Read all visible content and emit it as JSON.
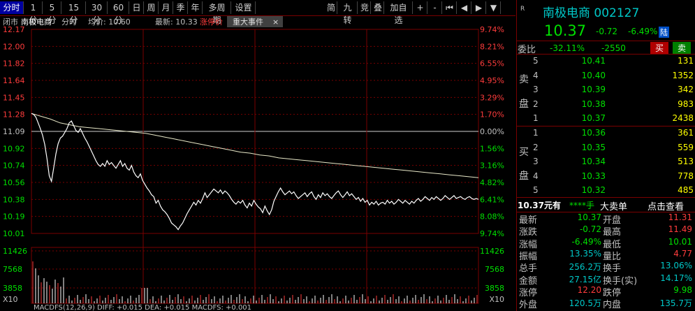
{
  "period_tabs": [
    "分时",
    "1分",
    "5分",
    "15分",
    "30分",
    "60分",
    "日",
    "周",
    "月",
    "季",
    "年",
    "多周期",
    "设置"
  ],
  "tool_tabs": [
    "简",
    "九转",
    "竞",
    "叠",
    "加自选",
    "+",
    "-",
    "⏮",
    "◀",
    "▶",
    "▼"
  ],
  "info_bar": {
    "closed": "闭市",
    "name": "南极电商",
    "mode": "分时",
    "avg_label": "均价:",
    "avg_value": "10.60",
    "latest_label": "最新:",
    "latest_value": "10.33",
    "limit_label": "涨停价",
    "event_tab": "重大事件",
    "event_close": "×"
  },
  "price_ticks": [
    "12.17",
    "12.00",
    "11.82",
    "11.64",
    "11.45",
    "11.28",
    "11.09",
    "10.92",
    "10.74",
    "10.56",
    "10.38",
    "10.19",
    "10.01"
  ],
  "pct_ticks": [
    "9.74%",
    "8.21%",
    "6.55%",
    "4.95%",
    "3.29%",
    "1.70%",
    "0.00%",
    "1.56%",
    "3.16%",
    "4.82%",
    "6.41%",
    "8.08%",
    "9.74%"
  ],
  "vol_ticks": [
    "11426",
    "7568",
    "3858"
  ],
  "vol_unit": "X10",
  "macd_label": "MACDFS(12,26,9)  DIFF: +0.015  DEA: +0.015  MACDFS: +0.001",
  "chart_data": {
    "type": "line",
    "title": "",
    "yaxis_base": 11.09,
    "ylim": [
      10.01,
      12.17
    ],
    "price": [
      11.28,
      11.27,
      11.24,
      11.18,
      11.12,
      11.05,
      10.95,
      10.8,
      10.62,
      10.56,
      10.7,
      10.85,
      10.96,
      11.02,
      11.04,
      11.08,
      11.12,
      11.18,
      11.2,
      11.15,
      11.1,
      11.08,
      11.12,
      11.07,
      11.02,
      10.98,
      10.93,
      10.88,
      10.83,
      10.78,
      10.74,
      10.72,
      10.75,
      10.72,
      10.78,
      10.74,
      10.76,
      10.73,
      10.7,
      10.74,
      10.78,
      10.72,
      10.75,
      10.7,
      10.68,
      10.73,
      10.66,
      10.62,
      10.6,
      10.64,
      10.57,
      10.53,
      10.49,
      10.46,
      10.42,
      10.4,
      10.33,
      10.36,
      10.3,
      10.26,
      10.24,
      10.21,
      10.17,
      10.12,
      10.1,
      10.08,
      10.05,
      10.09,
      10.12,
      10.17,
      10.22,
      10.26,
      10.3,
      10.34,
      10.31,
      10.36,
      10.33,
      10.38,
      10.44,
      10.39,
      10.42,
      10.45,
      10.48,
      10.46,
      10.44,
      10.47,
      10.43,
      10.46,
      10.44,
      10.41,
      10.37,
      10.34,
      10.32,
      10.35,
      10.33,
      10.36,
      10.31,
      10.28,
      10.33,
      10.3,
      10.36,
      10.32,
      10.29,
      10.27,
      10.23,
      10.3,
      10.25,
      10.21,
      10.26,
      10.35,
      10.4,
      10.45,
      10.49,
      10.45,
      10.42,
      10.44,
      10.46,
      10.43,
      10.45,
      10.41,
      10.38,
      10.4,
      10.42,
      10.44,
      10.4,
      10.43,
      10.45,
      10.4,
      10.37,
      10.42,
      10.39,
      10.44,
      10.41,
      10.43,
      10.4,
      10.38,
      10.41,
      10.44,
      10.46,
      10.42,
      10.39,
      10.42,
      10.45,
      10.41,
      10.43,
      10.4,
      10.37,
      10.39,
      10.35,
      10.38,
      10.34,
      10.36,
      10.31,
      10.34,
      10.32,
      10.35,
      10.31,
      10.33,
      10.34,
      10.32,
      10.36,
      10.33,
      10.35,
      10.32,
      10.34,
      10.37,
      10.35,
      10.33,
      10.36,
      10.34,
      10.32,
      10.35,
      10.33,
      10.36,
      10.38,
      10.35,
      10.37,
      10.4,
      10.38,
      10.36,
      10.39,
      10.37,
      10.4,
      10.38,
      10.36,
      10.38,
      10.41,
      10.39,
      10.37,
      10.39,
      10.41,
      10.38,
      10.39,
      10.4,
      10.38,
      10.37,
      10.39,
      10.4,
      10.38,
      10.37,
      10.38,
      10.37
    ],
    "avg": [
      11.28,
      11.25,
      11.22,
      11.18,
      11.16,
      11.14,
      11.13,
      11.12,
      11.11,
      11.1,
      11.09,
      11.08,
      11.07,
      11.05,
      11.03,
      11.01,
      10.99,
      10.97,
      10.95,
      10.93,
      10.91,
      10.89,
      10.87,
      10.86,
      10.84,
      10.83,
      10.81,
      10.8,
      10.79,
      10.78,
      10.77,
      10.76,
      10.75,
      10.74,
      10.73,
      10.72,
      10.71,
      10.7,
      10.69,
      10.68,
      10.67,
      10.66,
      10.65,
      10.64,
      10.63,
      10.62,
      10.61,
      10.6
    ]
  },
  "right": {
    "flag": "R",
    "stock_name": "南极电商 002127",
    "price": "10.37",
    "change": "-0.72",
    "change_pct": "-6.49%",
    "tag": "陆",
    "weibi_label": "委比",
    "weibi_pct": "-32.11%",
    "weibi_diff": "-2550",
    "buy_btn": "买",
    "sell_btn": "卖",
    "sell_label": [
      "卖",
      "盘"
    ],
    "buy_label": [
      "买",
      "盘"
    ],
    "asks": [
      {
        "lvl": "5",
        "price": "10.41",
        "vol": "131"
      },
      {
        "lvl": "4",
        "price": "10.40",
        "vol": "1352"
      },
      {
        "lvl": "3",
        "price": "10.39",
        "vol": "342"
      },
      {
        "lvl": "2",
        "price": "10.38",
        "vol": "983"
      },
      {
        "lvl": "1",
        "price": "10.37",
        "vol": "2438"
      }
    ],
    "bids": [
      {
        "lvl": "1",
        "price": "10.36",
        "vol": "361"
      },
      {
        "lvl": "2",
        "price": "10.35",
        "vol": "559"
      },
      {
        "lvl": "3",
        "price": "10.34",
        "vol": "513"
      },
      {
        "lvl": "4",
        "price": "10.33",
        "vol": "778"
      },
      {
        "lvl": "5",
        "price": "10.32",
        "vol": "485"
      }
    ],
    "unit_price": "10.37元有",
    "unit_hands": "****手",
    "big_trade": "大卖单",
    "click_view": "点击查看",
    "stats": [
      {
        "l1": "最新",
        "v1": "10.37",
        "l2": "开盘",
        "v2": "11.31"
      },
      {
        "l1": "涨跌",
        "v1": "-0.72",
        "l2": "最高",
        "v2": "11.49"
      },
      {
        "l1": "涨幅",
        "v1": "-6.49%",
        "l2": "最低",
        "v2": "10.01"
      },
      {
        "l1": "振幅",
        "v1": "13.35%",
        "l2": "量比",
        "v2": "4.77"
      },
      {
        "l1": "总手",
        "v1": "256.2万",
        "l2": "换手",
        "v2": "13.06%"
      },
      {
        "l1": "金额",
        "v1": "27.15亿",
        "l2": "换手(实)",
        "v2": "14.17%"
      },
      {
        "l1": "涨停",
        "v1": "12.20",
        "l2": "跌停",
        "v2": "9.98"
      },
      {
        "l1": "外盘",
        "v1": "120.5万",
        "l2": "内盘",
        "v2": "135.7万"
      }
    ]
  },
  "colors": {
    "up": "#ff3c3c",
    "down": "#00e000",
    "grid": "#7a0000",
    "line": "#ffffff",
    "avg": "#e8e8c8",
    "accent": "#00c8c8",
    "yellow": "#ffff00"
  }
}
